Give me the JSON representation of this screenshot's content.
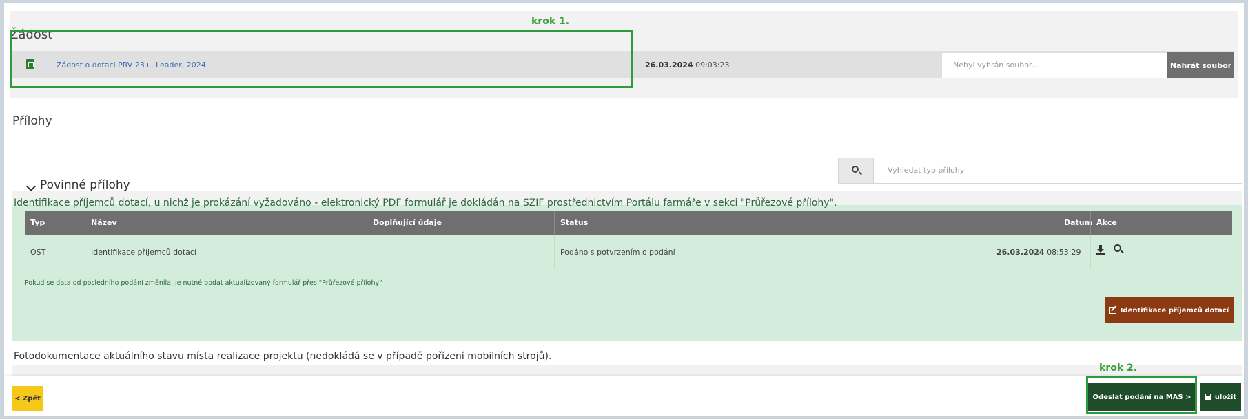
{
  "steps": {
    "step1": "krok 1.",
    "step2": "krok 2."
  },
  "zadost": {
    "title": "Žádost",
    "file_name": "Žádost o dotaci PRV 23+, Leader, 2024",
    "date": "26.03.2024",
    "time": "09:03:23",
    "file_input_placeholder": "Nebyl vybrán soubor...",
    "upload_label": "Nahrát soubor"
  },
  "prilohy": {
    "title": "Přílohy",
    "search_placeholder": "Vyhledat typ přílohy",
    "mandatory_title": "Povinné přílohy",
    "description": "Identifikace příjemců dotací, u nichž je prokázání vyžadováno - elektronický PDF formulář je dokládán na SZIF prostřednictvím Portálu farmáře v sekci \"Průřezové přílohy\".",
    "columns": {
      "typ": "Typ",
      "nazev": "Název",
      "doplnujici": "Doplňující údaje",
      "status": "Status",
      "datum": "Datum",
      "akce": "Akce"
    },
    "row": {
      "typ": "OST",
      "nazev": "Identifikace příjemců dotací",
      "doplnujici": "",
      "status": "Podáno s potvrzením o podání",
      "date": "26.03.2024",
      "time": "08:53:29"
    },
    "note": "Pokud se data od posledního podání změnila, je nutné podat aktualizovaný formulář přes \"Průřezové přílohy\"",
    "ident_button": "Identifikace příjemců dotací",
    "next_item": "Fotodokumentace aktuálního stavu místa realizace projektu (nedokládá se v případě pořízení mobilních strojů)."
  },
  "footer": {
    "back": "< Zpět",
    "send": "Odeslat podání na MAS >",
    "save": "uložit"
  },
  "colors": {
    "highlight": "#2e9b3f",
    "green_section": "#d4ecdc",
    "table_header": "#6f6f6f",
    "ident_button": "#8c3a12",
    "primary_dark_green": "#1f4d2b",
    "back_button": "#f6c81a",
    "link": "#3b6fb6"
  }
}
